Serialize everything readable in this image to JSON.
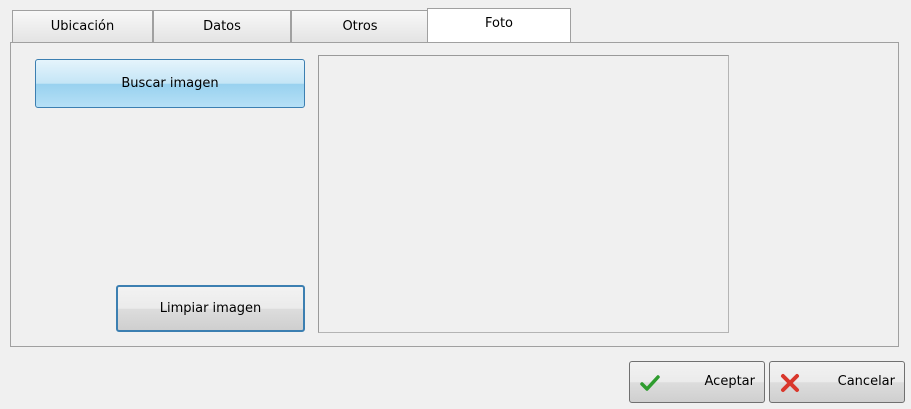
{
  "tabs": [
    {
      "label": "Ubicación"
    },
    {
      "label": "Datos"
    },
    {
      "label": "Otros"
    },
    {
      "label": "Foto"
    }
  ],
  "active_tab": "Foto",
  "photo_page": {
    "search_button": "Buscar imagen",
    "clear_button": "Limpiar imagen"
  },
  "footer": {
    "accept_button": "Aceptar",
    "cancel_button": "Cancelar"
  },
  "icons": {
    "accept": "green-check-icon",
    "cancel": "red-x-icon"
  },
  "colors": {
    "accept_icon": "#2e9c2e",
    "cancel_icon": "#d9372c",
    "selected_button_border": "#3c7fb1"
  }
}
